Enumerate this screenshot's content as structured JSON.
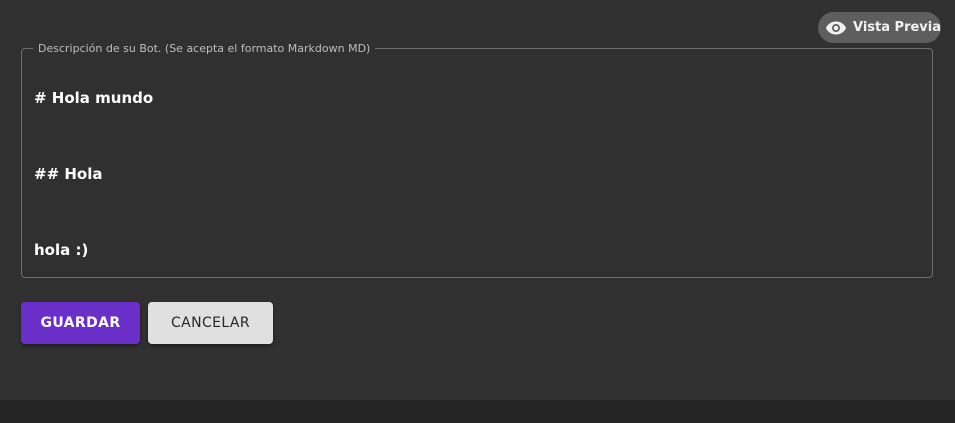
{
  "header": {
    "preview_label": "Vista Previa",
    "preview_icon": "eye-icon"
  },
  "description": {
    "legend": "Descripción de su Bot. (Se acepta el formato Markdown MD)",
    "value": "# Hola mundo\n\n## Hola\n\nhola :)"
  },
  "actions": {
    "save_label": "GUARDAR",
    "cancel_label": "CANCELAR"
  },
  "colors": {
    "background": "#303030",
    "primary": "#6b2fc9",
    "secondary": "#e0e0e0",
    "preview_bg": "#5e5e5e",
    "footer": "#242424"
  }
}
